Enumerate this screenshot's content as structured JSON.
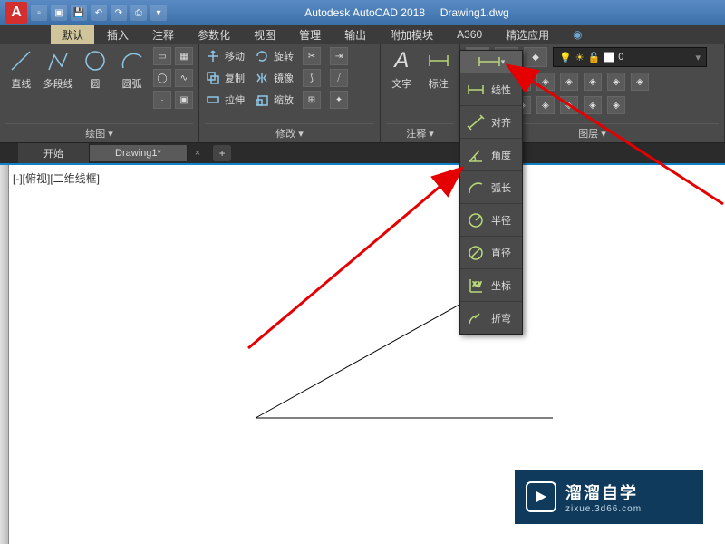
{
  "title": {
    "app": "Autodesk AutoCAD 2018",
    "file": "Drawing1.dwg"
  },
  "menu": {
    "tabs": [
      "默认",
      "插入",
      "注释",
      "参数化",
      "视图",
      "管理",
      "输出",
      "附加模块",
      "A360",
      "精选应用"
    ]
  },
  "ribbon": {
    "draw": {
      "title": "绘图 ▾",
      "line": "直线",
      "pline": "多段线",
      "circle": "圆",
      "arc": "圆弧"
    },
    "modify": {
      "title": "修改 ▾",
      "move": "移动",
      "copy": "复制",
      "stretch": "拉伸",
      "rotate": "旋转",
      "mirror": "镜像",
      "scale": "缩放"
    },
    "annotate": {
      "title": "注释 ▾",
      "text": "文字",
      "dim": "标注"
    },
    "layer": {
      "title": "图层 ▾",
      "current": "0"
    },
    "dim_btn": {
      "label": "线性"
    }
  },
  "flyout": {
    "items": [
      {
        "label": "线性"
      },
      {
        "label": "对齐"
      },
      {
        "label": "角度"
      },
      {
        "label": "弧长"
      },
      {
        "label": "半径"
      },
      {
        "label": "直径"
      },
      {
        "label": "坐标"
      },
      {
        "label": "折弯"
      }
    ]
  },
  "filetabs": {
    "start": "开始",
    "active": "Drawing1*"
  },
  "viewport": "[-][俯视][二维线框]",
  "watermark": {
    "t1": "溜溜自学",
    "t2": "zixue.3d66.com"
  }
}
